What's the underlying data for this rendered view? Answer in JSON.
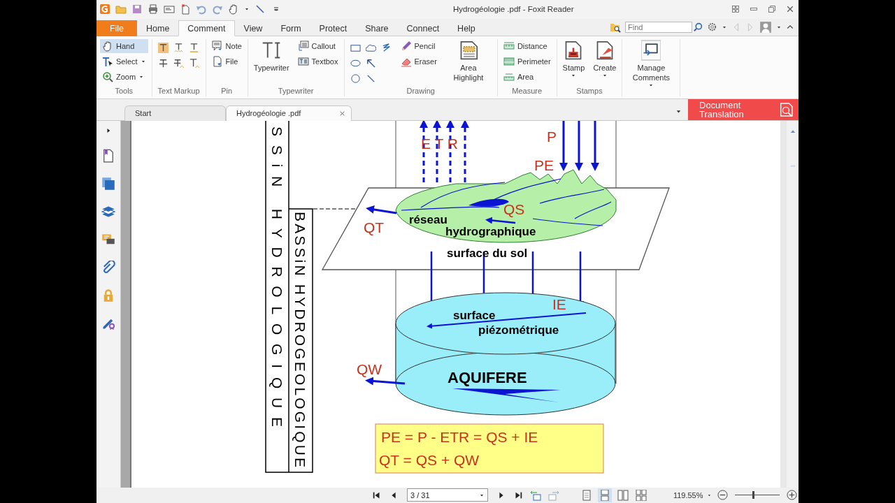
{
  "window": {
    "title": "Hydrogéologie .pdf - Foxit Reader"
  },
  "menu_tabs": [
    {
      "label": "File",
      "kind": "file",
      "selected": false
    },
    {
      "label": "Home",
      "kind": "tab",
      "selected": false
    },
    {
      "label": "Comment",
      "kind": "tab",
      "selected": true
    },
    {
      "label": "View",
      "kind": "tab",
      "selected": false
    },
    {
      "label": "Form",
      "kind": "tab",
      "selected": false
    },
    {
      "label": "Protect",
      "kind": "tab",
      "selected": false
    },
    {
      "label": "Share",
      "kind": "tab",
      "selected": false
    },
    {
      "label": "Connect",
      "kind": "tab",
      "selected": false
    },
    {
      "label": "Help",
      "kind": "tab",
      "selected": false
    }
  ],
  "search": {
    "placeholder": "Find"
  },
  "ribbon_groups": [
    {
      "label": "Tools",
      "sections": [
        {
          "kind": "small",
          "items": [
            {
              "label": "Hand",
              "selected": true,
              "menu": false
            },
            {
              "label": "Select",
              "selected": false,
              "menu": true
            },
            {
              "label": "Zoom",
              "selected": false,
              "menu": true
            }
          ]
        }
      ]
    },
    {
      "label": "Text Markup",
      "sections": [
        {
          "kind": "icons"
        }
      ]
    },
    {
      "label": "Pin",
      "sections": [
        {
          "kind": "small",
          "items": [
            {
              "label": "Note",
              "selected": false,
              "menu": false
            },
            {
              "label": "File",
              "selected": false,
              "menu": false
            }
          ]
        }
      ]
    },
    {
      "label": "Typewriter",
      "sections": [
        {
          "kind": "large",
          "items": [
            {
              "label": "Typewriter",
              "menu": false
            }
          ]
        },
        {
          "kind": "small",
          "items": [
            {
              "label": "Callout",
              "selected": false,
              "menu": false
            },
            {
              "label": "Textbox",
              "selected": false,
              "menu": false
            }
          ]
        }
      ]
    },
    {
      "label": "Drawing",
      "sections": [
        {
          "kind": "icons"
        },
        {
          "kind": "small",
          "items": [
            {
              "label": "Pencil",
              "selected": false,
              "menu": false
            },
            {
              "label": "Eraser",
              "selected": false,
              "menu": false
            }
          ]
        },
        {
          "kind": "large",
          "items": [
            {
              "label": "Area Highlight",
              "menu": false
            }
          ]
        }
      ]
    },
    {
      "label": "Measure",
      "sections": [
        {
          "kind": "small",
          "items": [
            {
              "label": "Distance",
              "selected": false,
              "menu": false
            },
            {
              "label": "Perimeter",
              "selected": false,
              "menu": false
            },
            {
              "label": "Area",
              "selected": false,
              "menu": false
            }
          ]
        }
      ]
    },
    {
      "label": "Stamps",
      "sections": [
        {
          "kind": "large",
          "items": [
            {
              "label": "Stamp",
              "menu": true
            },
            {
              "label": "Create",
              "menu": true
            }
          ]
        }
      ]
    },
    {
      "sections": [
        {
          "kind": "large",
          "items": [
            {
              "label": "Manage Comments",
              "menu": true
            }
          ]
        }
      ]
    }
  ],
  "doc_tabs": [
    {
      "label": "Start",
      "selected": false,
      "closable": false
    },
    {
      "label": "Hydrogéologie .pdf",
      "selected": true,
      "closable": true
    }
  ],
  "translation_button": {
    "label": "Document Translation"
  },
  "diagram": {
    "vertical_labels": [
      "SSiN HYDROLOGIQUE",
      "BASSiN HYDROGEOLOGIQUE"
    ],
    "flux_labels": [
      "E T R",
      "P",
      "PE",
      "QS",
      "QT",
      "IE",
      "QW"
    ],
    "captions": [
      "réseau",
      "hydrographique",
      "surface du sol",
      "surface",
      "piézométrique",
      "AQUIFERE"
    ],
    "formula": [
      "PE = P - ETR = QS + IE",
      "QT = QS + QW"
    ]
  },
  "status_bar": {
    "page": "3 / 31",
    "view_modes": [
      {
        "selected": false
      },
      {
        "selected": true
      },
      {
        "selected": false
      },
      {
        "selected": false
      }
    ],
    "zoom": "119.55%",
    "zoom_slider": {
      "level": 0.4
    }
  }
}
